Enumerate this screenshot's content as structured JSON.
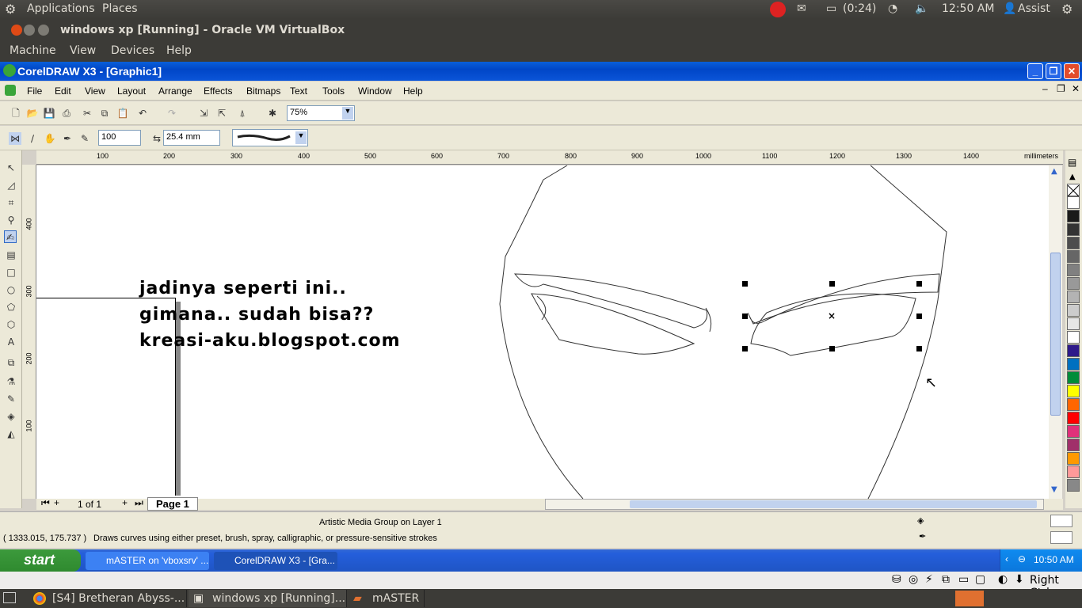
{
  "ubuntu_panel": {
    "applications": "Applications",
    "places": "Places",
    "battery": "(0:24)",
    "clock": "12:50 AM",
    "user": "Assist"
  },
  "vbox": {
    "title": "windows xp [Running] - Oracle VM VirtualBox",
    "menu": [
      "Machine",
      "View",
      "Devices",
      "Help"
    ],
    "host_key": "Right Ctrl"
  },
  "coreldraw": {
    "title": "CorelDRAW X3 - [Graphic1]",
    "menu": [
      "File",
      "Edit",
      "View",
      "Layout",
      "Arrange",
      "Effects",
      "Bitmaps",
      "Text",
      "Tools",
      "Window",
      "Help"
    ],
    "zoom": "75%",
    "size_value": "100",
    "width_value": "25.4 mm",
    "ruler_h_labels": [
      "100",
      "200",
      "300",
      "400",
      "500",
      "600",
      "700",
      "800",
      "900",
      "1000",
      "1100",
      "1200",
      "1300",
      "1400"
    ],
    "ruler_units": "millimeters",
    "ruler_v_labels": [
      "400",
      "300",
      "200",
      "100"
    ],
    "canvas_text": [
      "jadinya seperti ini..",
      "gimana.. sudah bisa??",
      "kreasi-aku.blogspot.com"
    ],
    "page_count": "1 of 1",
    "page_tab": "Page 1",
    "status_object": "Artistic Media Group on Layer 1",
    "status_coords": "( 1333.015, 175.737 )",
    "status_hint": "Draws curves using either preset, brush, spray, calligraphic, or pressure-sensitive strokes",
    "palette": [
      "#ffffff",
      "#1a1a1a",
      "#333333",
      "#4d4d4d",
      "#666666",
      "#808080",
      "#999999",
      "#b3b3b3",
      "#cccccc",
      "#e6e6e6",
      "#ffffff",
      "#2e1a8a",
      "#0070c0",
      "#008c3a",
      "#ffff00",
      "#ff6600",
      "#ff0000",
      "#e0307a",
      "#a0306a",
      "#ff9900",
      "#ff9999",
      "#888888"
    ]
  },
  "xp_taskbar": {
    "start": "start",
    "tasks": [
      "mASTER on 'vboxsrv' ...",
      "CorelDRAW X3 - [Gra..."
    ],
    "clock": "10:50 AM"
  },
  "ubuntu_taskbar": {
    "tasks": [
      "[S4] Bretheran Abyss-...",
      "windows xp [Running]...",
      "mASTER"
    ]
  }
}
